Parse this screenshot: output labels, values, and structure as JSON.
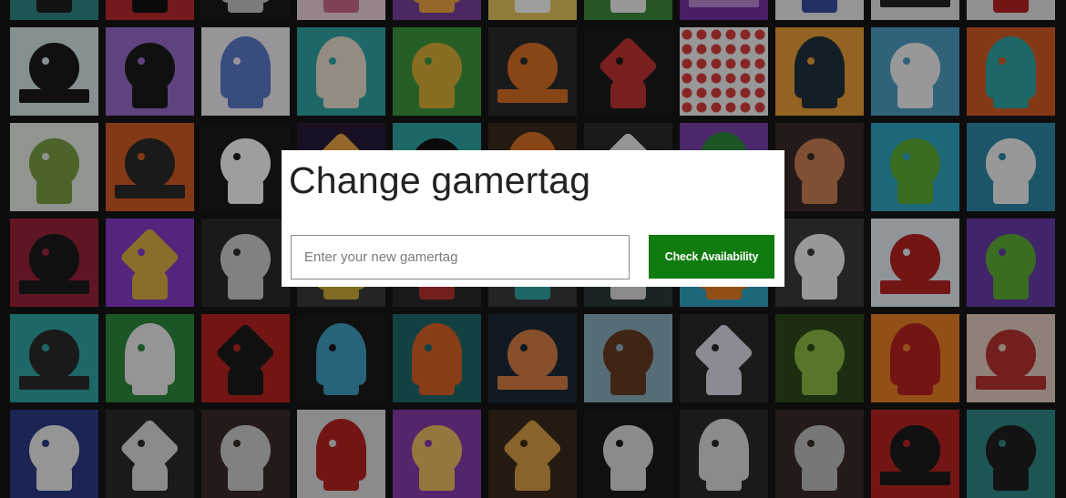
{
  "dialog": {
    "title": "Change gamertag",
    "input": {
      "placeholder": "Enter your new gamertag",
      "value": ""
    },
    "check_button_label": "Check Availability"
  },
  "colors": {
    "accent_green": "#107c10",
    "backdrop": "#0d0d0d",
    "dialog_background": "#ffffff"
  },
  "background_tiles": {
    "description_icon": "gamerpic-tile",
    "tiles": [
      {
        "bg": "#2b8a87",
        "fg": "#1e1e1e",
        "s": 0
      },
      {
        "bg": "#c1272d",
        "fg": "#111",
        "s": 1
      },
      {
        "bg": "#1a1a1a",
        "fg": "#c7c7c7",
        "s": 2
      },
      {
        "bg": "#f2d6e0",
        "fg": "#d36a8f",
        "s": 0
      },
      {
        "bg": "#7b3fa0",
        "fg": "#f2a83a",
        "s": 2
      },
      {
        "bg": "#e8c85a",
        "fg": "#fff",
        "s": 0
      },
      {
        "bg": "#3a8a3a",
        "fg": "#f5f5f5",
        "s": 1
      },
      {
        "bg": "#7a2fa8",
        "fg": "#c08ad8",
        "s": 3
      },
      {
        "bg": "#f0f0f0",
        "fg": "#3a4fa8",
        "s": 0
      },
      {
        "bg": "#e9e9e9",
        "fg": "#222",
        "s": 3
      },
      {
        "bg": "#e8e8e8",
        "fg": "#c02020",
        "s": 1
      },
      {
        "bg": "#d8e8e8",
        "fg": "#1a1a1a",
        "s": 3
      },
      {
        "bg": "#9a6bd0",
        "fg": "#1a1a1a",
        "s": 0
      },
      {
        "bg": "#f5f0f5",
        "fg": "#5a7ad0",
        "s": 2
      },
      {
        "bg": "#2aa8a8",
        "fg": "#f0e0d0",
        "s": 2
      },
      {
        "bg": "#3a9a3a",
        "fg": "#e0b030",
        "s": 0
      },
      {
        "bg": "#2a2a2a",
        "fg": "#e07020",
        "s": 3
      },
      {
        "bg": "#1a1a1a",
        "fg": "#c83030",
        "s": 1
      },
      {
        "bg": "#f5f5f5",
        "fg": "#e03a3a",
        "s": 9
      },
      {
        "bg": "#f0a030",
        "fg": "#203040",
        "s": 2
      },
      {
        "bg": "#4aa0c8",
        "fg": "#f5f5f5",
        "s": 0
      },
      {
        "bg": "#d85a20",
        "fg": "#2aa8a8",
        "s": 2
      },
      {
        "bg": "#e8f0e8",
        "fg": "#7aa040",
        "s": 0
      },
      {
        "bg": "#d85a20",
        "fg": "#2a2a2a",
        "s": 3
      },
      {
        "bg": "#1a1a1a",
        "fg": "#ffffff",
        "s": 0
      },
      {
        "bg": "#2a1a3a",
        "fg": "#f2a83a",
        "s": 1
      },
      {
        "bg": "#2aa8a8",
        "fg": "#111",
        "s": 0
      },
      {
        "bg": "#3a2a1a",
        "fg": "#e07020",
        "s": 2
      },
      {
        "bg": "#2a2a2a",
        "fg": "#f0f0f0",
        "s": 1
      },
      {
        "bg": "#7a3fb0",
        "fg": "#2a8a3a",
        "s": 2
      },
      {
        "bg": "#3a2a2a",
        "fg": "#d08050",
        "s": 0
      },
      {
        "bg": "#2aa8c8",
        "fg": "#5ab030",
        "s": 0
      },
      {
        "bg": "#2a8aa8",
        "fg": "#f5f5f5",
        "s": 0
      },
      {
        "bg": "#a0203a",
        "fg": "#1a1a1a",
        "s": 3
      },
      {
        "bg": "#8a3ad0",
        "fg": "#e0b040",
        "s": 1
      },
      {
        "bg": "#2a2a2a",
        "fg": "#d0d0d0",
        "s": 0
      },
      {
        "bg": "#3a3a3a",
        "fg": "#d0b030",
        "s": 2
      },
      {
        "bg": "#2a2a2a",
        "fg": "#c03030",
        "s": 0
      },
      {
        "bg": "#3a3a3a",
        "fg": "#2aa8a8",
        "s": 1
      },
      {
        "bg": "#2a3a3a",
        "fg": "#e0e0e0",
        "s": 0
      },
      {
        "bg": "#2aa8c8",
        "fg": "#f08020",
        "s": 2
      },
      {
        "bg": "#3a3a3a",
        "fg": "#f5f5f5",
        "s": 0
      },
      {
        "bg": "#e8f0f8",
        "fg": "#c02020",
        "s": 3
      },
      {
        "bg": "#6a3ab0",
        "fg": "#5ab030",
        "s": 0
      },
      {
        "bg": "#2aa8a8",
        "fg": "#2a2a2a",
        "s": 3
      },
      {
        "bg": "#2a8a3a",
        "fg": "#f0f0f0",
        "s": 2
      },
      {
        "bg": "#c02020",
        "fg": "#1a1a1a",
        "s": 1
      },
      {
        "bg": "#1a1a1a",
        "fg": "#3aa0c8",
        "s": 2
      },
      {
        "bg": "#1a6a6a",
        "fg": "#e06020",
        "s": 2
      },
      {
        "bg": "#1a2a3a",
        "fg": "#e08040",
        "s": 3
      },
      {
        "bg": "#8ab0c0",
        "fg": "#6a3a20",
        "s": 0
      },
      {
        "bg": "#2a2a2a",
        "fg": "#e0e0f0",
        "s": 1
      },
      {
        "bg": "#2a4a1a",
        "fg": "#8ac040",
        "s": 0
      },
      {
        "bg": "#f08020",
        "fg": "#c02020",
        "s": 2
      },
      {
        "bg": "#e8d0c0",
        "fg": "#c03030",
        "s": 3
      },
      {
        "bg": "#2a3a8a",
        "fg": "#f0f0f0",
        "s": 0
      },
      {
        "bg": "#2a2a2a",
        "fg": "#e0e0e0",
        "s": 1
      },
      {
        "bg": "#3a2a2a",
        "fg": "#d0d0d0",
        "s": 0
      },
      {
        "bg": "#e0e0e0",
        "fg": "#c02020",
        "s": 2
      },
      {
        "bg": "#8a3ab0",
        "fg": "#f0c060",
        "s": 0
      },
      {
        "bg": "#3a2a1a",
        "fg": "#e0a040",
        "s": 1
      },
      {
        "bg": "#1a1a1a",
        "fg": "#e0e0e0",
        "s": 0
      },
      {
        "bg": "#2a2a2a",
        "fg": "#e0e0e0",
        "s": 2
      },
      {
        "bg": "#3a2a2a",
        "fg": "#c0c0c0",
        "s": 0
      },
      {
        "bg": "#c02020",
        "fg": "#1a1a1a",
        "s": 3
      }
    ]
  }
}
